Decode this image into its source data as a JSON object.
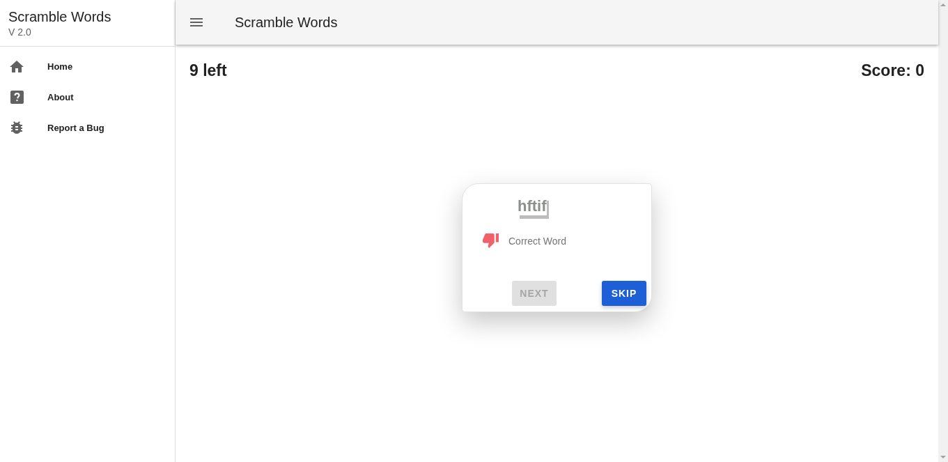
{
  "sidebar": {
    "title": "Scramble Words",
    "version": "V 2.0",
    "items": [
      {
        "label": "Home",
        "selected": false
      },
      {
        "label": "About",
        "selected": false
      },
      {
        "label": "Report a Bug",
        "selected": false
      }
    ]
  },
  "app_bar": {
    "title": "Scramble Words"
  },
  "status": {
    "remaining": "9 left",
    "score": "Score: 0"
  },
  "card": {
    "scrambled_word": "hftif",
    "answer": {
      "placeholder": "Correct Word",
      "correct": false
    },
    "buttons": [
      {
        "label": "NEXT",
        "disabled": true
      },
      {
        "label": "SKIP",
        "disabled": false
      }
    ]
  }
}
